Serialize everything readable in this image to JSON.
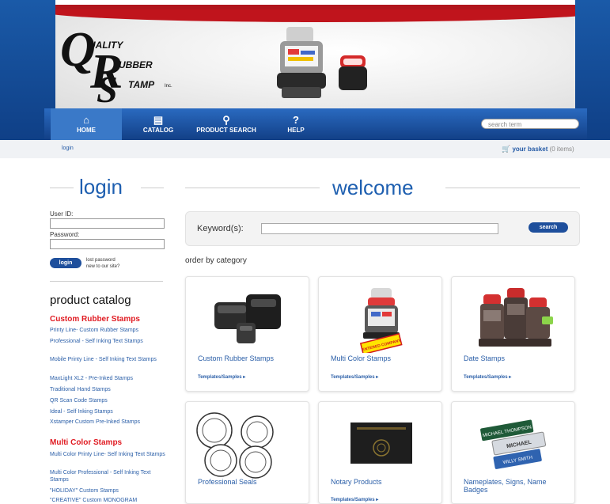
{
  "header": {
    "logo": {
      "quality": "UALITY",
      "rubber": "UBBER",
      "stamp": "TAMP",
      "inc": "Inc."
    },
    "search_placeholder": "search term"
  },
  "nav": {
    "items": [
      {
        "label": "HOME",
        "icon": "home-icon"
      },
      {
        "label": "CATALOG",
        "icon": "book-icon"
      },
      {
        "label": "PRODUCT SEARCH",
        "icon": "search-icon"
      },
      {
        "label": "HELP",
        "icon": "help-icon"
      }
    ]
  },
  "breadcrumb": {
    "current": "login"
  },
  "basket": {
    "label": "your basket",
    "count": "(0 items)"
  },
  "login": {
    "title": "login",
    "user_label": "User ID:",
    "password_label": "Password:",
    "button": "login",
    "lost_password": "lost password",
    "new_site": "new to our site?"
  },
  "catalog": {
    "title": "product catalog",
    "sections": [
      {
        "heading": "Custom Rubber Stamps",
        "links": [
          "Printy Line- Custom Rubber Stamps",
          "Professional - Self Inking Text Stamps",
          "Mobile Printy Line - Self Inking Text Stamps",
          "MaxLight XL2 - Pre-Inked Stamps",
          "Traditional Hand Stamps",
          "QR Scan Code Stamps",
          "Ideal - Self Inking Stamps",
          "Xstamper Custom Pre-Inked Stamps"
        ]
      },
      {
        "heading": "Multi Color Stamps",
        "links": [
          "Multi Color Printy Line- Self Inking Text Stamps",
          "Multi Color Professional - Self Inking Text Stamps",
          "\"HOLIDAY\" Custom Stamps",
          "\"CREATIVE\" Custom MONOGRAM"
        ]
      }
    ]
  },
  "main": {
    "title": "welcome",
    "keyword_label": "Keyword(s):",
    "search_button": "search",
    "order_heading": "order by category",
    "categories": [
      {
        "name": "Custom Rubber Stamps",
        "link": "Templates/Samples ▸"
      },
      {
        "name": "Multi Color Stamps",
        "link": "Templates/Samples ▸",
        "badge": "ENTERED COMPANY"
      },
      {
        "name": "Date Stamps",
        "link": "Templates/Samples ▸"
      },
      {
        "name": "Professional Seals"
      },
      {
        "name": "Notary Products",
        "link": "Templates/Samples ▸"
      },
      {
        "name": "Nameplates, Signs, Name Badges",
        "plates": [
          "MICHAEL THOMPSON",
          "MICHAEL",
          "WILLY SMITH"
        ]
      }
    ]
  }
}
